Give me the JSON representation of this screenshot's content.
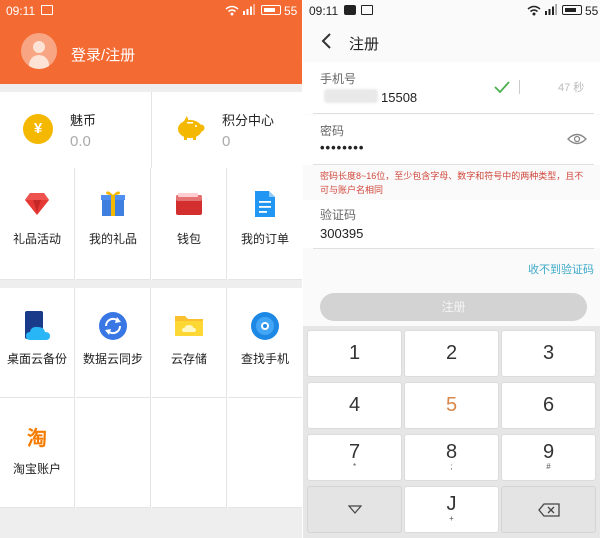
{
  "left_screen": {
    "status_bar": {
      "time": "09:11",
      "battery": "55"
    },
    "header": {
      "login_text": "登录/注册"
    },
    "coins": [
      {
        "title": "魅币",
        "value": "0.0",
        "icon": "coin-icon",
        "icon_text": "¥"
      },
      {
        "title": "积分中心",
        "value": "0",
        "icon": "piggy-bank-icon"
      }
    ],
    "grid_row1": [
      {
        "label": "礼品活动",
        "icon": "diamond-icon"
      },
      {
        "label": "我的礼品",
        "icon": "gift-icon"
      },
      {
        "label": "钱包",
        "icon": "wallet-icon"
      },
      {
        "label": "我的订单",
        "icon": "document-icon"
      }
    ],
    "grid_row2": [
      {
        "label": "桌面云备份",
        "icon": "cloud-backup-icon"
      },
      {
        "label": "数据云同步",
        "icon": "sync-icon"
      },
      {
        "label": "云存储",
        "icon": "folder-icon"
      },
      {
        "label": "查找手机",
        "icon": "locate-icon"
      }
    ],
    "grid_row3": [
      {
        "label": "淘宝账户",
        "icon": "taobao-icon",
        "icon_text": "淘"
      }
    ],
    "colors": {
      "header": "#f46a33",
      "coin": "#f5b800"
    }
  },
  "right_screen": {
    "status_bar": {
      "time": "09:11",
      "battery": "55"
    },
    "title": "注册",
    "phone": {
      "label": "手机号",
      "value_suffix": "15508",
      "countdown": "47 秒"
    },
    "password": {
      "label": "密码",
      "value": "••••••••",
      "hint": "密码长度8~16位，至少包含字母、数字和符号中的两种类型，且不可与账户名相同"
    },
    "code": {
      "label": "验证码",
      "value": "300395",
      "resend": "收不到验证码"
    },
    "register_button": "注册",
    "keypad": [
      {
        "main": "1",
        "sub": ""
      },
      {
        "main": "2",
        "sub": ""
      },
      {
        "main": "3",
        "sub": ""
      },
      {
        "main": "4",
        "sub": ""
      },
      {
        "main": "5",
        "sub": ""
      },
      {
        "main": "6",
        "sub": ""
      },
      {
        "main": "7",
        "sub": "*"
      },
      {
        "main": "8",
        "sub": ";"
      },
      {
        "main": "9",
        "sub": "#"
      },
      {
        "main": "",
        "sub": "",
        "icon": "collapse-keyboard-icon"
      },
      {
        "main": "J",
        "sub": "+"
      },
      {
        "main": "",
        "sub": "",
        "icon": "backspace-icon"
      }
    ],
    "colors": {
      "hint": "#d0473c",
      "link": "#3ea9c9",
      "check": "#4caf50"
    }
  }
}
